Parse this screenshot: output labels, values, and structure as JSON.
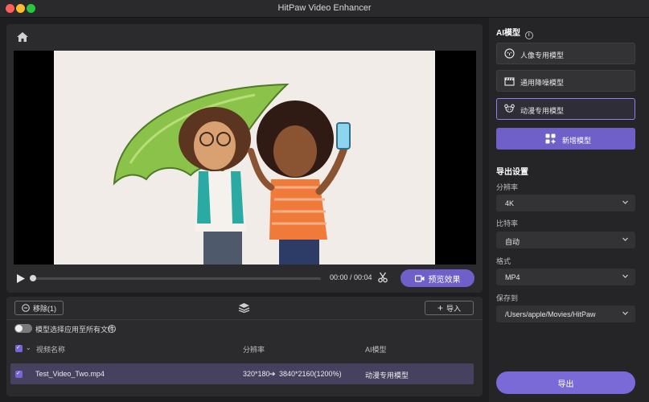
{
  "window": {
    "title": "HitPaw Video Enhancer"
  },
  "player": {
    "time": "00:00 / 00:04",
    "progress": 0.0,
    "preview_label": "预览效果"
  },
  "file_list": {
    "remove_label": "移除(1)",
    "import_label": "导入",
    "apply_all_label": "模型选择应用至所有文件",
    "apply_all_enabled": false,
    "columns": {
      "name": "视频名称",
      "resolution": "分辨率",
      "model": "AI模型"
    },
    "rows": [
      {
        "name": "Test_Video_Two.mp4",
        "from_res": "320*180",
        "to_res": "3840*2160(1200%)",
        "model": "动漫专用模型",
        "checked": true
      }
    ]
  },
  "sidebar": {
    "ai_title": "AI模型",
    "models": [
      {
        "label": "人像专用模型",
        "icon": "face-icon",
        "active": false
      },
      {
        "label": "通用降噪模型",
        "icon": "clapperboard-icon",
        "active": false
      },
      {
        "label": "动漫专用模型",
        "icon": "bear-icon",
        "active": true
      }
    ],
    "add_model_label": "新增模型",
    "export_title": "导出设置",
    "resolution": {
      "label": "分辨率",
      "value": "4K"
    },
    "bitrate": {
      "label": "比特率",
      "value": "自动"
    },
    "format": {
      "label": "格式",
      "value": "MP4"
    },
    "save_to": {
      "label": "保存到",
      "value": "/Users/apple/Movies/HitPaw"
    },
    "export_label": "导出"
  },
  "colors": {
    "accent": "#6f5fc8",
    "active_border": "#8f7ff0",
    "row_highlight": "#45415f"
  }
}
